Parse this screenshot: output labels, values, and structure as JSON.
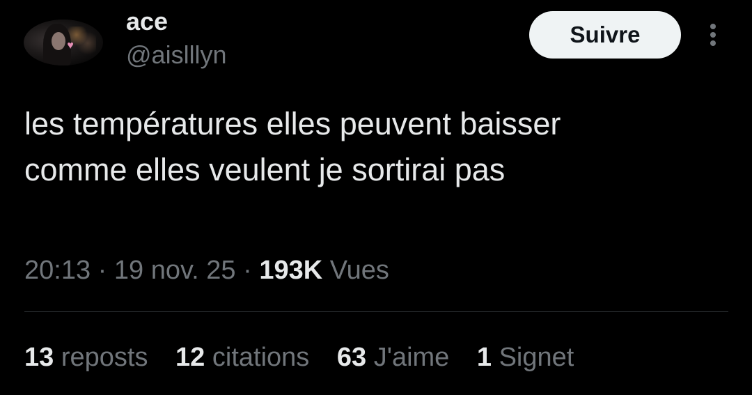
{
  "author": {
    "display_name": "ace",
    "handle": "@aislllyn",
    "avatar_icon": "profile-photo"
  },
  "follow_button": {
    "label": "Suivre"
  },
  "more_icon": "more-vertical-icon",
  "tweet": {
    "text_line1": "les températures elles peuvent baisser",
    "text_line2": "comme elles veulent je sortirai pas"
  },
  "meta": {
    "time": "20:13",
    "date": "19 nov. 25",
    "separator": "·",
    "views_count": "193K",
    "views_label": "Vues"
  },
  "stats": {
    "reposts": {
      "count": "13",
      "label": "reposts"
    },
    "quotes": {
      "count": "12",
      "label": "citations"
    },
    "likes": {
      "count": "63",
      "label": "J'aime"
    },
    "bookmarks": {
      "count": "1",
      "label": "Signet"
    }
  },
  "colors": {
    "background": "#000000",
    "primary_text": "#e7e9ea",
    "secondary_text": "#71767b",
    "button_bg": "#eff3f4",
    "divider": "#2f3336"
  }
}
